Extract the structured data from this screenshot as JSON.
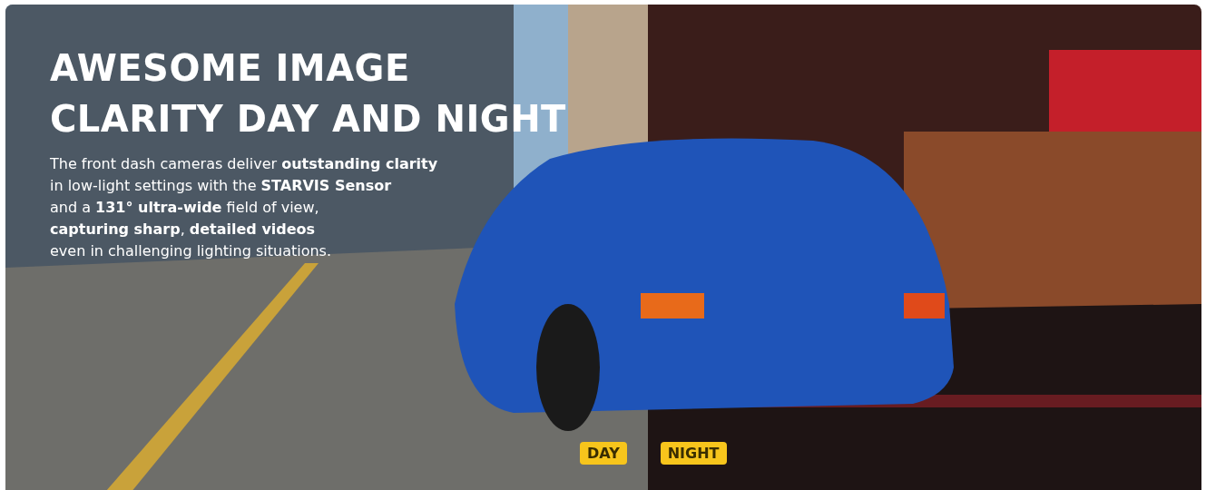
{
  "hero": {
    "kind": "picture",
    "heading_lines": [
      "AWESOME IMAGE",
      "CLARITY DAY AND NIGHT"
    ],
    "description_lines": [
      "The front dash cameras deliver **outstanding clarity**",
      "in low-light settings with the **STARVIS Sensor**",
      "and a **131° ultra-wide** field of view,",
      "**capturing sharp**, **detailed videos**",
      "even in challenging lighting situations."
    ],
    "labels": [
      "DAY",
      "NIGHT"
    ]
  }
}
